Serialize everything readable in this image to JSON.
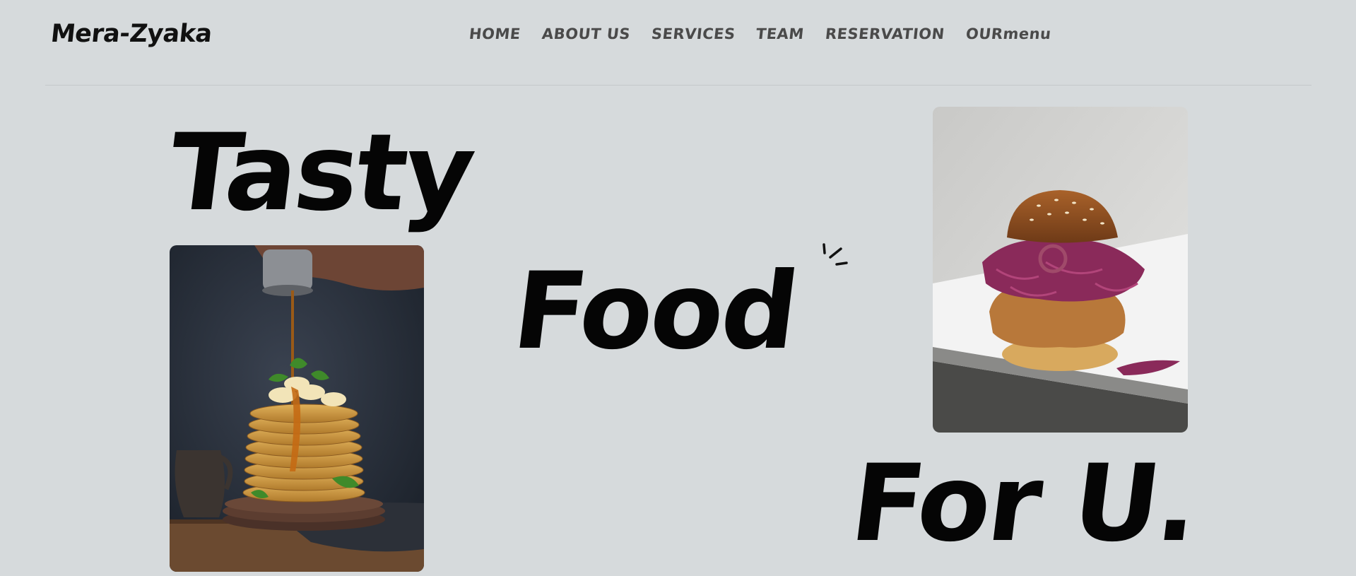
{
  "brand": {
    "name": "Mera-Zyaka"
  },
  "nav": {
    "items": [
      {
        "label": "HOME"
      },
      {
        "label": "ABOUT US"
      },
      {
        "label": "SERVICES"
      },
      {
        "label": "TEAM"
      },
      {
        "label": "RESERVATION"
      },
      {
        "label": "OURmenu"
      }
    ]
  },
  "hero": {
    "word1": "Tasty",
    "word2": "Food",
    "word3": "For U."
  },
  "colors": {
    "background": "#d6dadc",
    "text": "#050505",
    "nav_text": "#4a4a4a"
  }
}
